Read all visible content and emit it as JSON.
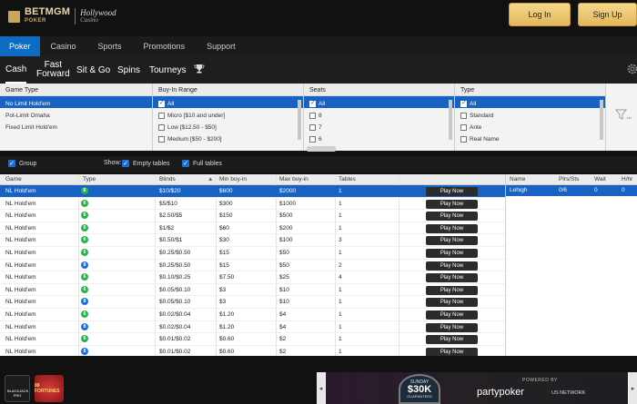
{
  "header": {
    "logo_primary": "BETMGM",
    "logo_secondary": "POKER",
    "logo_partner": "Hollywood",
    "logo_partner_sub": "Casino",
    "login_label": "Log In",
    "signup_label": "Sign Up"
  },
  "mainnav": [
    {
      "label": "Poker",
      "active": true
    },
    {
      "label": "Casino"
    },
    {
      "label": "Sports"
    },
    {
      "label": "Promotions"
    },
    {
      "label": "Support"
    }
  ],
  "subnav": {
    "cash": "Cash",
    "fast1": "Fast",
    "fast2": "Forward",
    "sitgo": "Sit & Go",
    "spins": "Spins",
    "tourneys": "Tourneys"
  },
  "filters": {
    "game_type": {
      "header": "Game Type",
      "items": [
        "No Limit Hold'em",
        "Pot-Limit Omaha",
        "Fixed Limit Hold'em"
      ]
    },
    "buyin": {
      "header": "Buy-In Range",
      "items": [
        "All",
        "Micro [$10 and under]",
        "Low [$12.50 - $50]",
        "Medium [$50 - $200]"
      ]
    },
    "seats": {
      "header": "Seats",
      "items": [
        "All",
        "8",
        "7",
        "6"
      ]
    },
    "type": {
      "header": "Type",
      "items": [
        "All",
        "Standard",
        "Ante",
        "Real Name"
      ]
    }
  },
  "options": {
    "group": "Group",
    "show": "Show:",
    "empty": "Empty tables",
    "full": "Full tables"
  },
  "grid": {
    "headers": [
      "Game",
      "Type",
      "Blinds",
      "Min buy-in",
      "Max buy-in",
      "Tables"
    ],
    "play_label": "Play Now",
    "rows": [
      {
        "game": "NL Hold'em",
        "chip": "6",
        "color": "g",
        "blinds": "$10/$20",
        "min": "$600",
        "max": "$2000",
        "tables": "1"
      },
      {
        "game": "NL Hold'em",
        "chip": "6",
        "color": "g",
        "blinds": "$5/$10",
        "min": "$300",
        "max": "$1000",
        "tables": "1"
      },
      {
        "game": "NL Hold'em",
        "chip": "6",
        "color": "g",
        "blinds": "$2.50/$5",
        "min": "$150",
        "max": "$500",
        "tables": "1"
      },
      {
        "game": "NL Hold'em",
        "chip": "6",
        "color": "g",
        "blinds": "$1/$2",
        "min": "$60",
        "max": "$200",
        "tables": "1"
      },
      {
        "game": "NL Hold'em",
        "chip": "6",
        "color": "g",
        "blinds": "$0.50/$1",
        "min": "$30",
        "max": "$100",
        "tables": "3"
      },
      {
        "game": "NL Hold'em",
        "chip": "6",
        "color": "g",
        "blinds": "$0.25/$0.50",
        "min": "$15",
        "max": "$50",
        "tables": "1"
      },
      {
        "game": "NL Hold'em",
        "chip": "8",
        "color": "b",
        "blinds": "$0.25/$0.50",
        "min": "$15",
        "max": "$50",
        "tables": "2"
      },
      {
        "game": "NL Hold'em",
        "chip": "6",
        "color": "g",
        "blinds": "$0.10/$0.25",
        "min": "$7.50",
        "max": "$25",
        "tables": "4"
      },
      {
        "game": "NL Hold'em",
        "chip": "6",
        "color": "g",
        "blinds": "$0.05/$0.10",
        "min": "$3",
        "max": "$10",
        "tables": "1"
      },
      {
        "game": "NL Hold'em",
        "chip": "8",
        "color": "b",
        "blinds": "$0.05/$0.10",
        "min": "$3",
        "max": "$10",
        "tables": "1"
      },
      {
        "game": "NL Hold'em",
        "chip": "6",
        "color": "g",
        "blinds": "$0.02/$0.04",
        "min": "$1.20",
        "max": "$4",
        "tables": "1"
      },
      {
        "game": "NL Hold'em",
        "chip": "8",
        "color": "b",
        "blinds": "$0.02/$0.04",
        "min": "$1.20",
        "max": "$4",
        "tables": "1"
      },
      {
        "game": "NL Hold'em",
        "chip": "6",
        "color": "g",
        "blinds": "$0.01/$0.02",
        "min": "$0.60",
        "max": "$2",
        "tables": "1"
      },
      {
        "game": "NL Hold'em",
        "chip": "8",
        "color": "b",
        "blinds": "$0.01/$0.02",
        "min": "$0.60",
        "max": "$2",
        "tables": "1"
      }
    ]
  },
  "players": {
    "headers": [
      "Name",
      "Plrs/Sts",
      "Wait",
      "H/hr"
    ],
    "row": {
      "name": "Lehigh",
      "plrs": "0/6",
      "wait": "0",
      "hhr": "0"
    }
  },
  "bottom": {
    "game1": "BLACKJACK PRO",
    "game2": "88 FORTUNES",
    "banner_line1": "SUNDAY",
    "banner_line2": "$30K",
    "banner_line3": "GUARANTEED",
    "powered": "POWERED BY",
    "brand": "partypoker",
    "network": "US NETWORK"
  },
  "colors": {
    "accent": "#0d6bc3",
    "selection": "#1862c4",
    "gold": "#e3b75a"
  }
}
